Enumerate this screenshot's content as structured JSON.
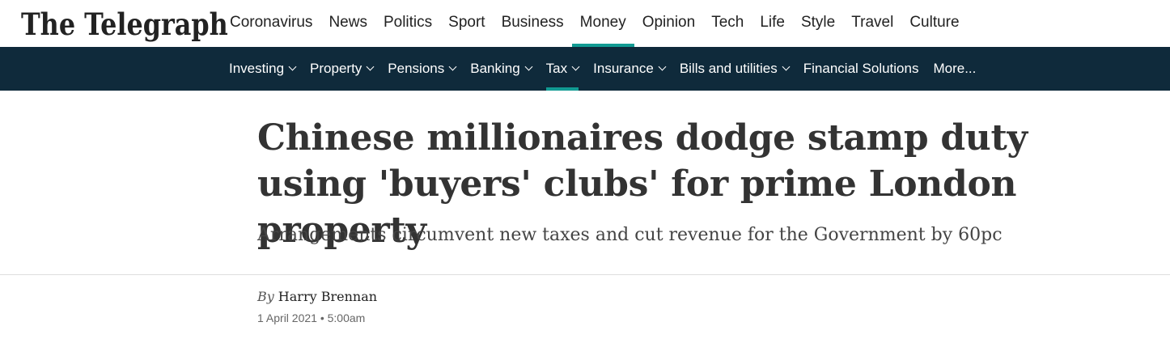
{
  "colors": {
    "nav_bg": "#0f2a3b",
    "accent": "#129b93",
    "text": "#222222"
  },
  "logo": {
    "text": "The Telegraph"
  },
  "main_nav": {
    "items": [
      {
        "label": "Coronavirus"
      },
      {
        "label": "News"
      },
      {
        "label": "Politics"
      },
      {
        "label": "Sport"
      },
      {
        "label": "Business"
      },
      {
        "label": "Money",
        "active": true
      },
      {
        "label": "Opinion"
      },
      {
        "label": "Tech"
      },
      {
        "label": "Life"
      },
      {
        "label": "Style"
      },
      {
        "label": "Travel"
      },
      {
        "label": "Culture"
      }
    ]
  },
  "sub_nav": {
    "items": [
      {
        "label": "Investing",
        "dropdown": true
      },
      {
        "label": "Property",
        "dropdown": true
      },
      {
        "label": "Pensions",
        "dropdown": true
      },
      {
        "label": "Banking",
        "dropdown": true
      },
      {
        "label": "Tax",
        "dropdown": true,
        "active": true
      },
      {
        "label": "Insurance",
        "dropdown": true
      },
      {
        "label": "Bills and utilities",
        "dropdown": true
      },
      {
        "label": "Financial Solutions",
        "dropdown": false
      },
      {
        "label": "More...",
        "dropdown": false
      }
    ]
  },
  "article": {
    "headline": "Chinese millionaires dodge stamp duty using 'buyers' clubs' for prime London property",
    "standfirst": "Arrangements circumvent new taxes and cut revenue for the Government by 60pc",
    "byline_prefix": "By",
    "author": "Harry Brennan",
    "date": "1 April 2021 • 5:00am"
  }
}
